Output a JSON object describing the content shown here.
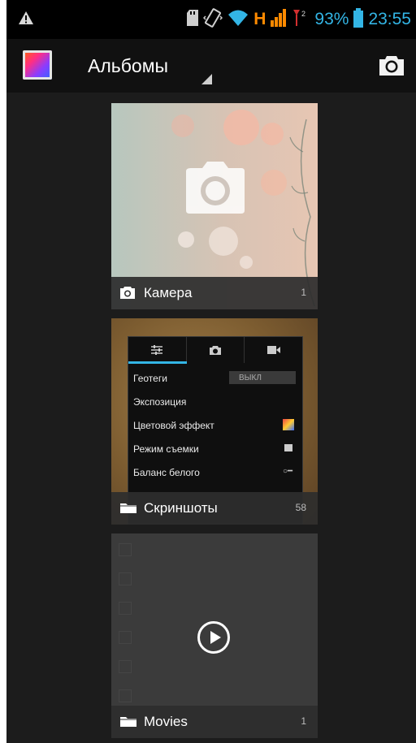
{
  "status_bar": {
    "battery_percent": "93%",
    "time": "23:55",
    "network_type": "H",
    "icons": [
      "warning-icon",
      "sd-card-icon",
      "vibrate-icon",
      "wifi-icon",
      "signal-icon",
      "roaming-signal-icon",
      "battery-icon"
    ],
    "accent_color": "#33b5e5",
    "network_color": "#ff8a00"
  },
  "action_bar": {
    "title": "Альбомы",
    "icons": [
      "gallery-app-icon",
      "dropdown-spinner-icon",
      "camera-icon"
    ]
  },
  "albums": [
    {
      "label": "Камера",
      "count": "1",
      "icon": "camera-icon"
    },
    {
      "label": "Скриншоты",
      "count": "58",
      "icon": "folder-icon",
      "thumb": {
        "rows": [
          "Геотеги",
          "Экспозиция",
          "Цветовой эффект",
          "Режим съемки",
          "Баланс белого"
        ],
        "toggle_value": "ВЫКЛ"
      }
    },
    {
      "label": "Movies",
      "count": "1",
      "icon": "folder-icon"
    }
  ]
}
